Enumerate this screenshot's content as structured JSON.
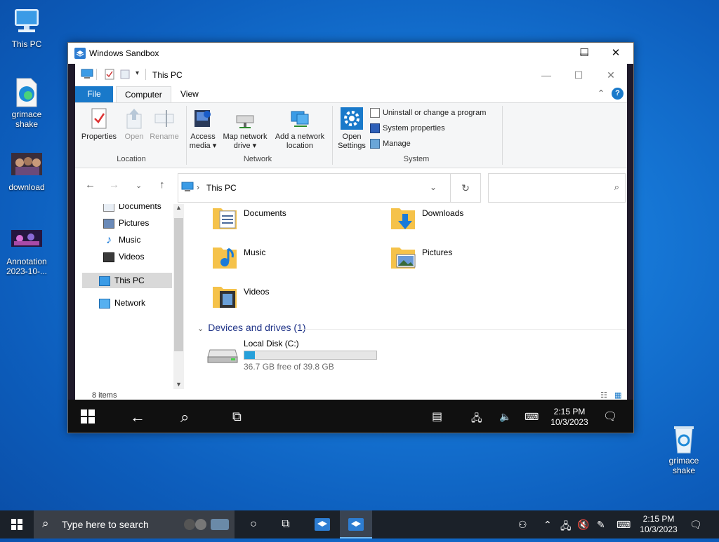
{
  "desktop": {
    "icons": [
      {
        "label": "This PC",
        "icon": "computer-icon"
      },
      {
        "label": "grimace shake",
        "icon": "edge-file-icon"
      },
      {
        "label": "download",
        "icon": "image-thumbnail-icon"
      },
      {
        "label": "Annotation 2023-10-...",
        "icon": "image-thumbnail-icon"
      },
      {
        "label": "grimace shake",
        "icon": "recycle-bin-icon"
      }
    ]
  },
  "sandbox": {
    "title": "Windows Sandbox",
    "minimize": "—",
    "maximize": "☐",
    "close": "✕"
  },
  "explorer": {
    "title": "This PC",
    "tabs": {
      "file": "File",
      "computer": "Computer",
      "view": "View"
    },
    "ribbon": {
      "properties": "Properties",
      "open": "Open",
      "rename": "Rename",
      "location_group": "Location",
      "access_media_l1": "Access",
      "access_media_l2": "media ▾",
      "map_drive_l1": "Map network",
      "map_drive_l2": "drive ▾",
      "add_location_l1": "Add a network",
      "add_location_l2": "location",
      "network_group": "Network",
      "open_settings_l1": "Open",
      "open_settings_l2": "Settings",
      "uninstall": "Uninstall or change a program",
      "system_properties": "System properties",
      "manage": "Manage",
      "system_group": "System"
    },
    "address": {
      "path": "This PC",
      "separator": "›"
    },
    "nav_pane": [
      {
        "label": "Documents"
      },
      {
        "label": "Pictures"
      },
      {
        "label": "Music"
      },
      {
        "label": "Videos"
      },
      {
        "label": "This PC"
      },
      {
        "label": "Network"
      }
    ],
    "folders": [
      {
        "name": "Documents"
      },
      {
        "name": "Downloads"
      },
      {
        "name": "Music"
      },
      {
        "name": "Pictures"
      },
      {
        "name": "Videos"
      }
    ],
    "devices_header": "Devices and drives (1)",
    "drive": {
      "name": "Local Disk (C:)",
      "free": "36.7 GB free of 39.8 GB",
      "used_fraction": 0.078
    },
    "status": "8 items"
  },
  "remote_taskbar": {
    "time": "2:15 PM",
    "date": "10/3/2023"
  },
  "taskbar": {
    "search_placeholder": "Type here to search",
    "time": "2:15 PM",
    "date": "10/3/2023"
  },
  "colors": {
    "accent": "#1979ca",
    "selection": "#d9d9d9",
    "drive_fill": "#26a0da",
    "taskbar": "#1b2129"
  }
}
